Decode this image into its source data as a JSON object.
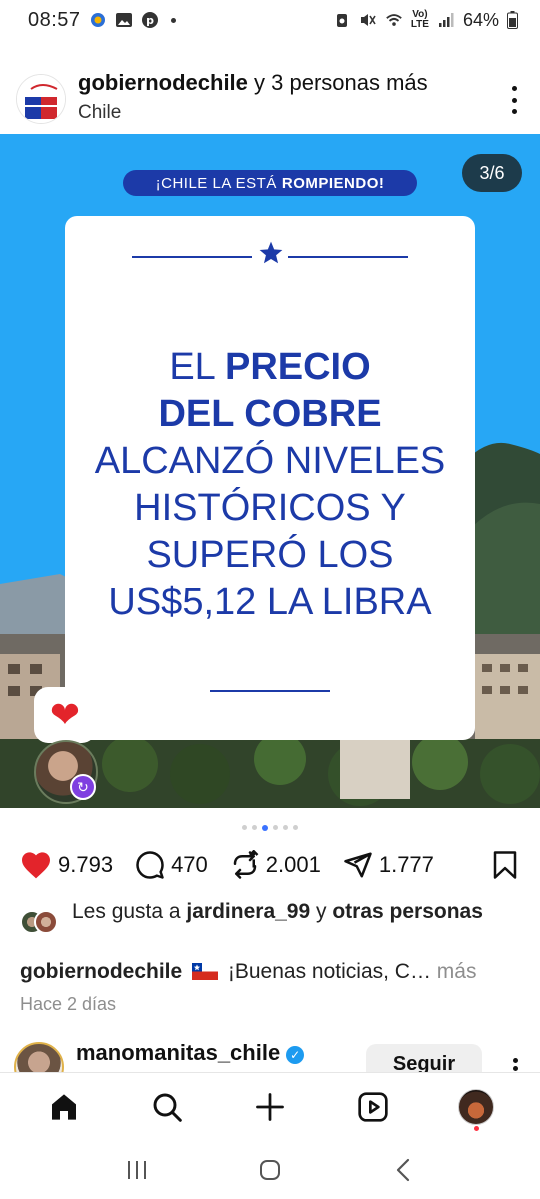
{
  "status_bar": {
    "time": "08:57",
    "battery": "64%",
    "network": "LTE",
    "volte": "Vo)"
  },
  "post": {
    "author": "gobiernodechile",
    "author_suffix": " y 3 personas más",
    "location": "Chile",
    "slide_counter": "3/6",
    "banner_prefix": "¡CHILE LA ESTÁ",
    "banner_bold": "ROMPIENDO!",
    "card_lines": [
      {
        "text_a": "EL ",
        "text_b": "PRECIO"
      },
      {
        "text_b": "DEL COBRE"
      },
      {
        "text_a": "ALCANZÓ NIVELES"
      },
      {
        "text_a": "HISTÓRICOS Y"
      },
      {
        "text_a": "SUPERÓ LOS"
      },
      {
        "text_a": "US$5,12 LA LIBRA"
      }
    ],
    "reaction_emoji": "❤",
    "carousel": {
      "count": 6,
      "active_index": 2
    },
    "likes_count": "9.793",
    "comments_count": "470",
    "reposts_count": "2.001",
    "shares_count": "1.777",
    "likes_prefix": "Les gusta a ",
    "likes_user": "jardinera_99",
    "likes_middle": " y ",
    "likes_suffix": "otras personas",
    "caption_user": "gobiernodechile",
    "caption_text": "¡Buenas noticias, C…",
    "caption_more": " más",
    "time_ago": "Hace 2 días",
    "colors": {
      "sky": "#27a7f5",
      "brand_blue": "#1c3aa8",
      "like_red": "#e3242b"
    }
  },
  "next_post": {
    "author": "manomanitas_chile",
    "follow_label": "Seguir"
  },
  "bottom_nav": {
    "items": [
      "home-icon",
      "search-icon",
      "create-icon",
      "reels-icon",
      "profile-avatar"
    ]
  },
  "system_nav": {
    "items": [
      "recents-icon",
      "home-circle-icon",
      "back-icon"
    ]
  }
}
